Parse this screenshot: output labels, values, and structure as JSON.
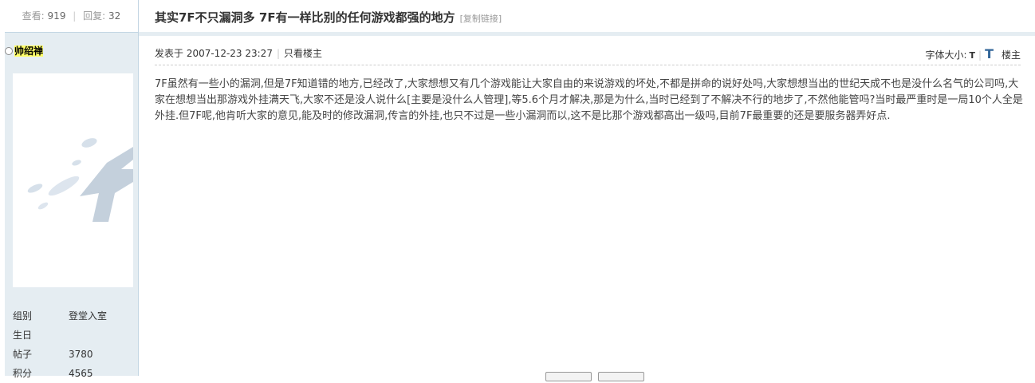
{
  "sidebar": {
    "views_label": "查看:",
    "views_value": "919",
    "replies_label": "回复:",
    "replies_value": "32",
    "author_name": "帅绍禅",
    "profile": [
      {
        "key": "组别",
        "value": "登堂入室"
      },
      {
        "key": "生日",
        "value": ""
      },
      {
        "key": "帖子",
        "value": "3780"
      },
      {
        "key": "积分",
        "value": "4565"
      }
    ]
  },
  "post": {
    "title": "其实7F不只漏洞多 7F有一样比别的任何游戏都强的地方",
    "copy_link": "[复制链接]",
    "posted_at": "发表于 2007-12-23 23:27",
    "only_author": "只看楼主",
    "font_size_label": "字体大小:",
    "font_small": "T",
    "font_big": "T",
    "floor": "楼主",
    "content": "7F虽然有一些小的漏洞,但是7F知道错的地方,已经改了,大家想想又有几个游戏能让大家自由的来说游戏的坏处,不都是拼命的说好处吗,大家想想当出的世纪天成不也是没什么名气的公司吗,大家在想想当出那游戏外挂满天飞,大家不还是没人说什么[主要是没什么人管理],等5.6个月才解决,那是为什么,当时已经到了不解决不行的地步了,不然他能管吗?当时最严重时是一局10个人全是外挂.但7F呢,他肯听大家的意见,能及时的修改漏洞,传言的外挂,也只不过是一些小漏洞而以,这不是比那个游戏都高出一级吗,目前7F最重要的还是要服务器弄好点."
  },
  "colors": {
    "sidebar_bg": "#e5edf2",
    "border": "#c2d5e3",
    "highlight": "#ffff66"
  }
}
